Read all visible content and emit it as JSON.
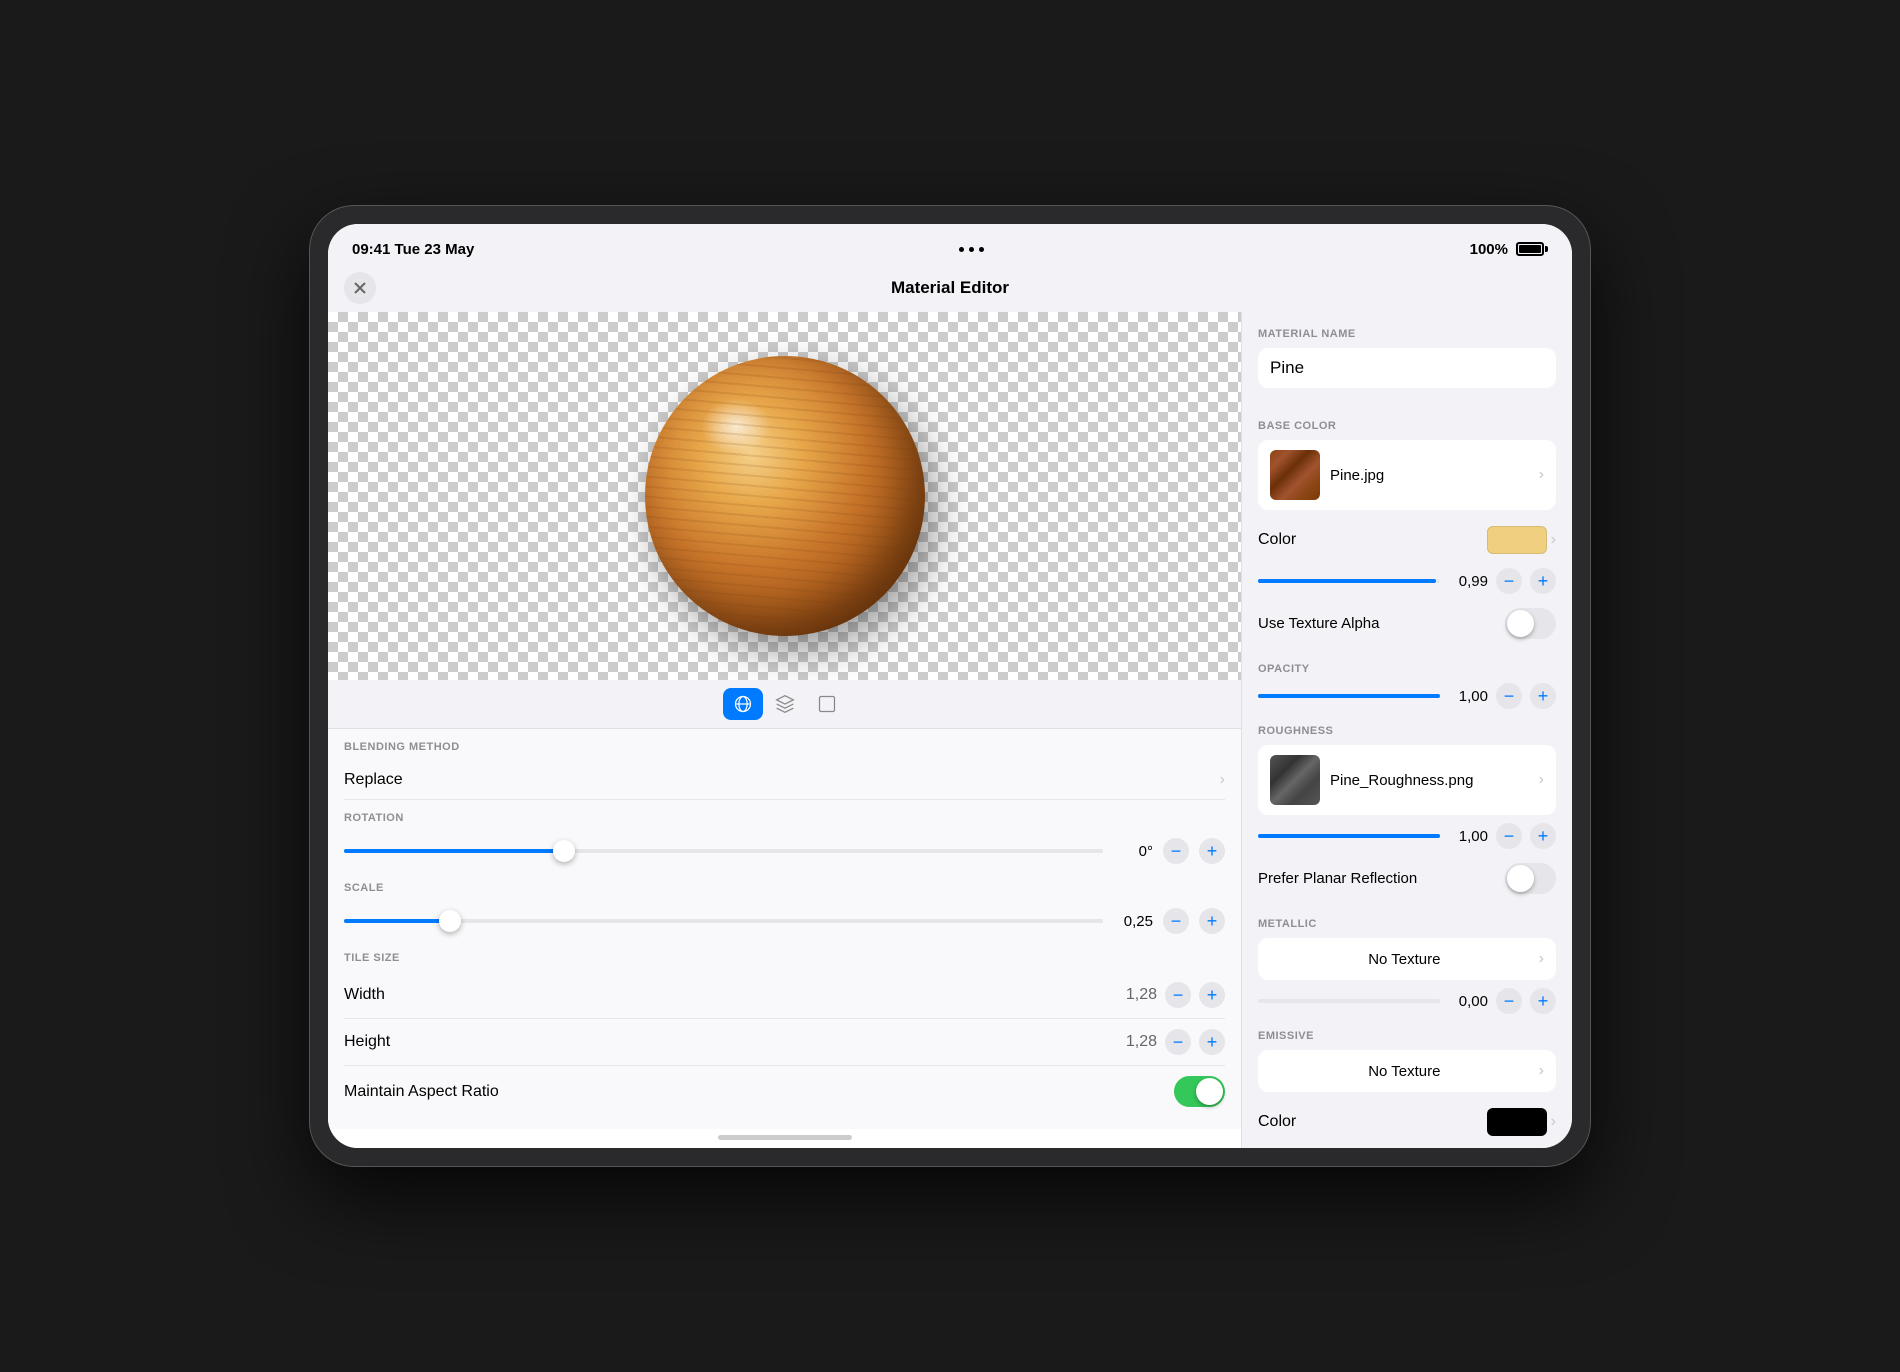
{
  "statusBar": {
    "time": "09:41",
    "date": "Tue 23 May",
    "battery": "100%"
  },
  "appBar": {
    "title": "Material Editor",
    "closeLabel": "×"
  },
  "viewControls": {
    "sphere": "sphere-view",
    "box": "box-view",
    "plane": "plane-view",
    "activeView": "sphere"
  },
  "leftControls": {
    "blendingMethod": {
      "sectionLabel": "BLENDING METHOD",
      "value": "Replace"
    },
    "rotation": {
      "sectionLabel": "ROTATION",
      "value": "0°",
      "sliderPercent": 29
    },
    "scale": {
      "sectionLabel": "SCALE",
      "value": "0,25",
      "sliderPercent": 14
    },
    "tileSize": {
      "sectionLabel": "TILE SIZE",
      "width": {
        "label": "Width",
        "value": "1,28"
      },
      "height": {
        "label": "Height",
        "value": "1,28"
      },
      "maintainAspectRatio": {
        "label": "Maintain Aspect Ratio",
        "enabled": true
      }
    }
  },
  "rightPanel": {
    "materialNameSection": "MATERIAL NAME",
    "materialName": "Pine",
    "baseColorSection": "BASE COLOR",
    "baseColorTexture": "Pine.jpg",
    "colorLabel": "Color",
    "colorSwatch": "#f0d080",
    "opacityValue": "0,99",
    "opacitySliderPercent": 98,
    "useTextureAlpha": {
      "label": "Use Texture Alpha",
      "enabled": false
    },
    "opacitySection": "OPACITY",
    "opacityRowValue": "1,00",
    "opacityRowSliderPercent": 100,
    "roughnessSection": "ROUGHNESS",
    "roughnessTexture": "Pine_Roughness.png",
    "roughnessValue": "1,00",
    "roughnessSliderPercent": 100,
    "preferPlanarReflection": {
      "label": "Prefer Planar Reflection",
      "enabled": false
    },
    "metallicSection": "METALLIC",
    "metallicNoTexture": "No Texture",
    "metallicValue": "0,00",
    "metallicSliderPercent": 0,
    "emissiveSection": "EMISSIVE",
    "emissiveNoTexture": "No Texture",
    "emissiveColorLabel": "Color",
    "emissiveColorSwatch": "#000000"
  }
}
